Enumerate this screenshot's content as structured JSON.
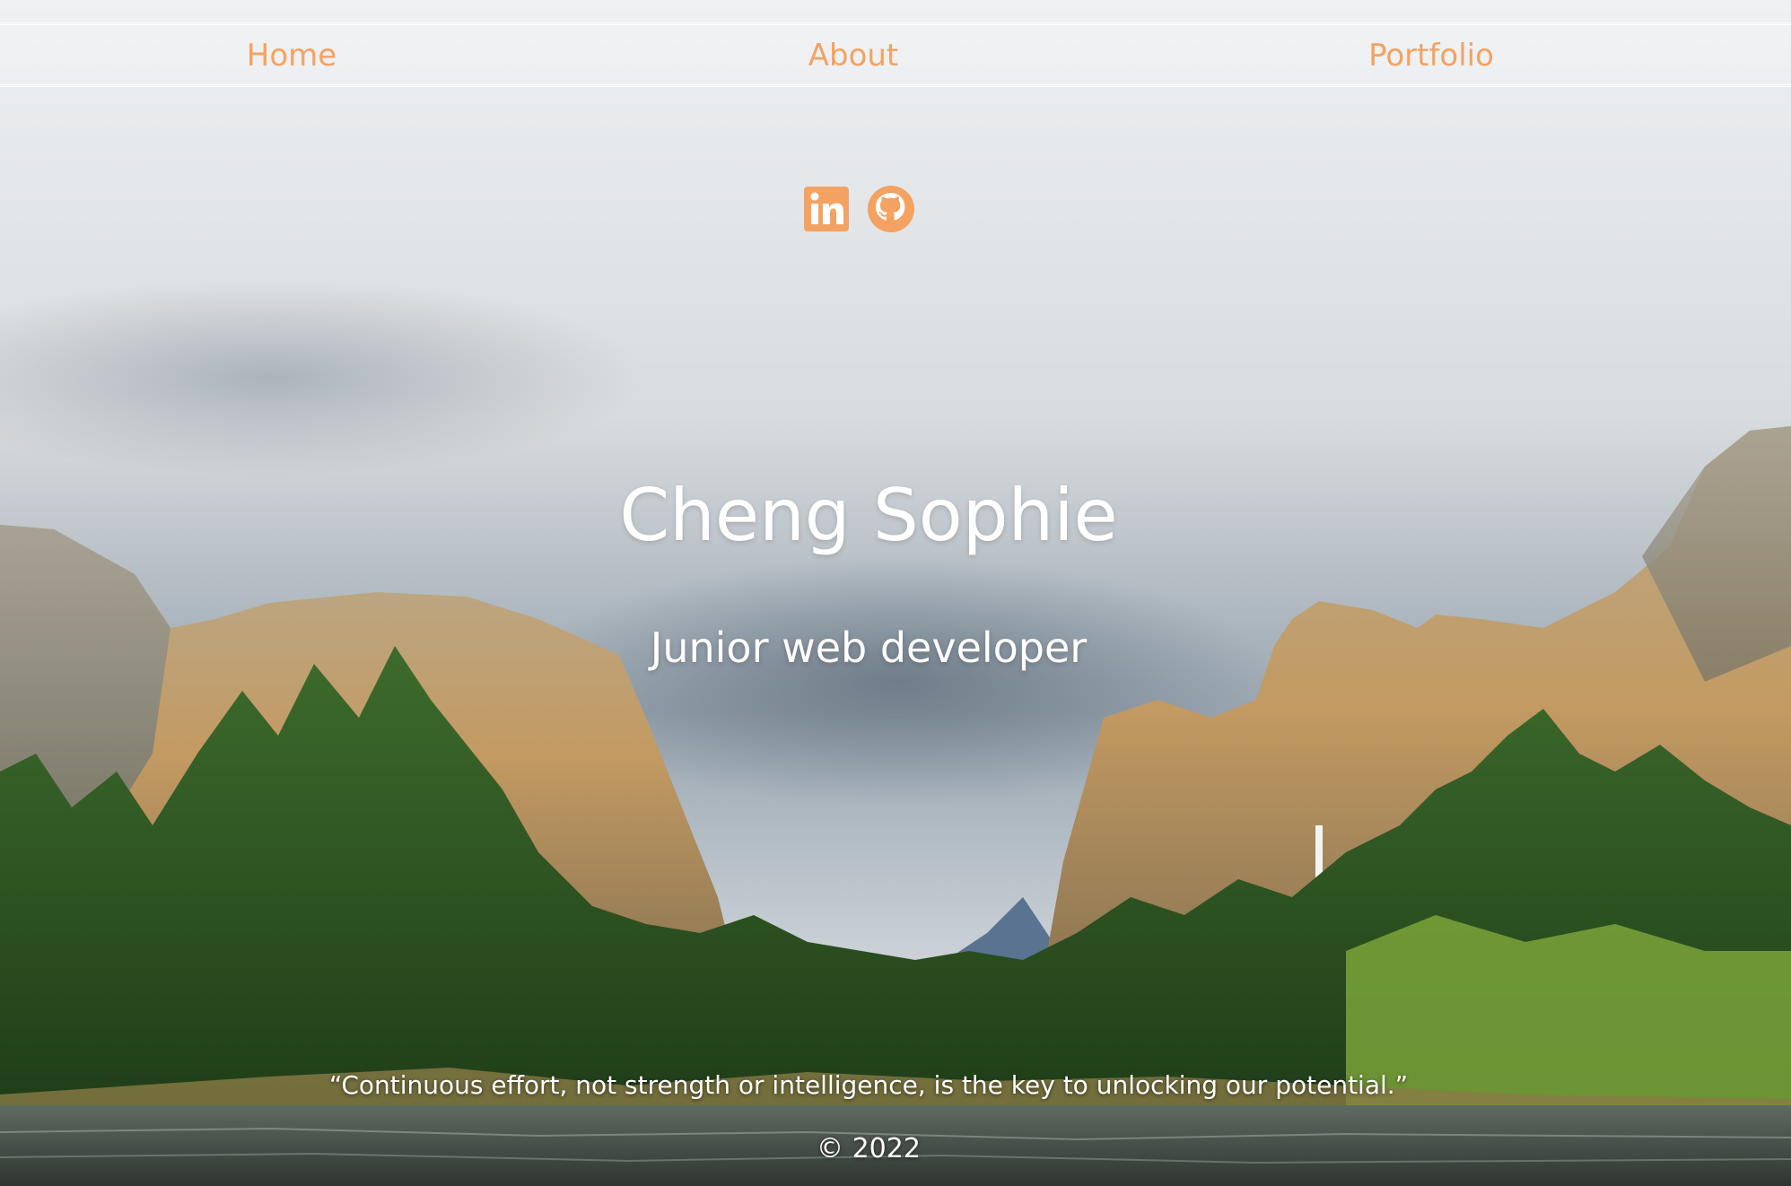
{
  "nav": {
    "items": [
      {
        "label": "Home"
      },
      {
        "label": "About"
      },
      {
        "label": "Portfolio"
      }
    ]
  },
  "social": {
    "icons": [
      "linkedin-icon",
      "github-icon"
    ]
  },
  "hero": {
    "name": "Cheng Sophie",
    "title": "Junior web developer"
  },
  "footer": {
    "quote": "“Continuous effort, not strength or intelligence, is the key to unlocking our potential.”",
    "copyright": "© 2022"
  },
  "colors": {
    "accent": "#f4a261",
    "text": "#ffffff"
  }
}
